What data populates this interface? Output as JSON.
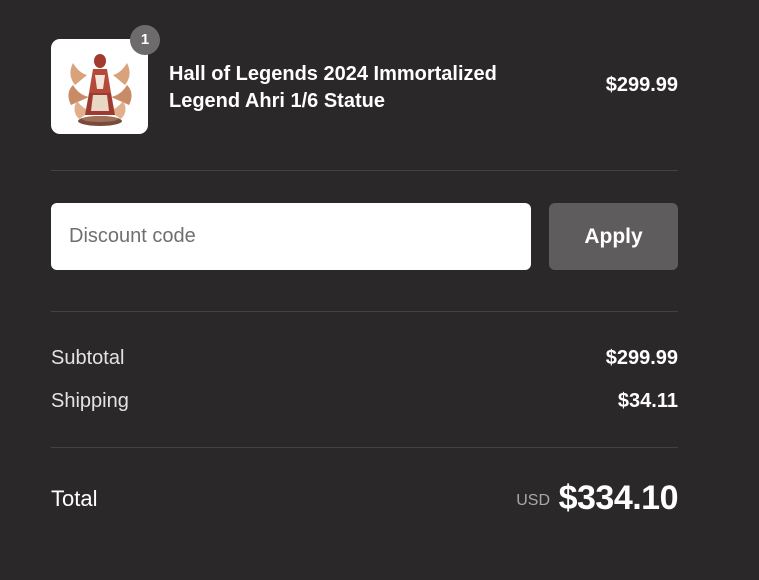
{
  "product": {
    "quantity": "1",
    "title": "Hall of Legends 2024 Immortalized Legend Ahri 1/6 Statue",
    "price": "$299.99",
    "image_icon": "statue-image"
  },
  "discount": {
    "placeholder": "Discount code",
    "value": "",
    "apply_label": "Apply"
  },
  "totals": {
    "subtotal_label": "Subtotal",
    "subtotal_value": "$299.99",
    "shipping_label": "Shipping",
    "shipping_value": "$34.11"
  },
  "grand_total": {
    "label": "Total",
    "currency": "USD",
    "amount": "$334.10"
  },
  "colors": {
    "background": "#2a2828",
    "button": "#5e5c5c",
    "badge": "#6d6b6b",
    "divider": "#454242"
  }
}
